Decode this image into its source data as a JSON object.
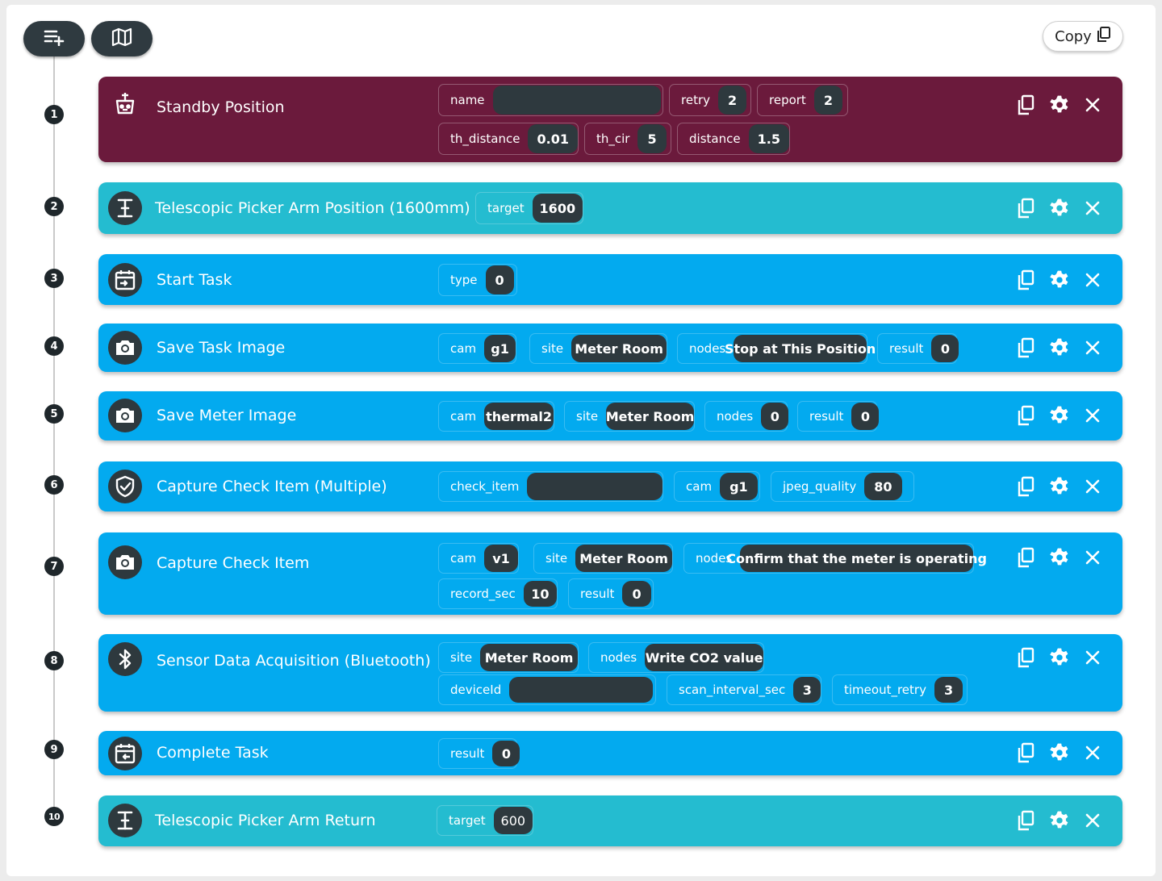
{
  "toolbar": {
    "add_icon": "playlist-add-icon",
    "map_icon": "map-icon",
    "copy_label": "Copy",
    "copy_icon": "copy-icon"
  },
  "colors": {
    "maroon": "#6b1a3c",
    "teal": "#24bcd0",
    "blue": "#03aaef",
    "pill": "#2e393e"
  },
  "steps": [
    {
      "number": "1",
      "title": "Standby Position",
      "icon": "robot-base-icon",
      "params": [
        {
          "label": "name",
          "value": ""
        },
        {
          "label": "retry",
          "value": "2"
        },
        {
          "label": "report",
          "value": "2"
        },
        {
          "label": "th_distance",
          "value": "0.01"
        },
        {
          "label": "th_cir",
          "value": "5"
        },
        {
          "label": "distance",
          "value": "1.5"
        }
      ]
    },
    {
      "number": "2",
      "title": "Telescopic Picker Arm Position (1600mm)",
      "icon": "telescopic-arm-icon",
      "params": [
        {
          "label": "target",
          "value": "1600"
        }
      ]
    },
    {
      "number": "3",
      "title": "Start Task",
      "icon": "calendar-start-icon",
      "params": [
        {
          "label": "type",
          "value": "0"
        }
      ]
    },
    {
      "number": "4",
      "title": "Save Task Image",
      "icon": "camera-icon",
      "params": [
        {
          "label": "cam",
          "value": "g1"
        },
        {
          "label": "site",
          "value": "Meter Room"
        },
        {
          "label": "nodes",
          "value": "Stop at This Position"
        },
        {
          "label": "result",
          "value": "0"
        }
      ]
    },
    {
      "number": "5",
      "title": "Save Meter Image",
      "icon": "camera-icon",
      "params": [
        {
          "label": "cam",
          "value": "thermal2"
        },
        {
          "label": "site",
          "value": "Meter Room"
        },
        {
          "label": "nodes",
          "value": "0"
        },
        {
          "label": "result",
          "value": "0"
        }
      ]
    },
    {
      "number": "6",
      "title": "Capture Check Item (Multiple)",
      "icon": "shield-check-icon",
      "params": [
        {
          "label": "check_item",
          "value": ""
        },
        {
          "label": "cam",
          "value": "g1"
        },
        {
          "label": "jpeg_quality",
          "value": "80"
        }
      ]
    },
    {
      "number": "7",
      "title": "Capture Check Item",
      "icon": "camera-icon",
      "params": [
        {
          "label": "cam",
          "value": "v1"
        },
        {
          "label": "site",
          "value": "Meter Room"
        },
        {
          "label": "nodes",
          "value": "Confirm that the meter is operating"
        },
        {
          "label": "record_sec",
          "value": "10"
        },
        {
          "label": "result",
          "value": "0"
        }
      ]
    },
    {
      "number": "8",
      "title": "Sensor Data Acquisition (Bluetooth)",
      "icon": "bluetooth-icon",
      "params": [
        {
          "label": "site",
          "value": "Meter Room"
        },
        {
          "label": "nodes",
          "value": "Write CO2 value"
        },
        {
          "label": "deviceId",
          "value": ""
        },
        {
          "label": "scan_interval_sec",
          "value": "3"
        },
        {
          "label": "timeout_retry",
          "value": "3"
        }
      ]
    },
    {
      "number": "9",
      "title": "Complete Task",
      "icon": "calendar-complete-icon",
      "params": [
        {
          "label": "result",
          "value": "0"
        }
      ]
    },
    {
      "number": "10",
      "title": "Telescopic Picker Arm Return",
      "icon": "telescopic-arm-icon",
      "params": [
        {
          "label": "target",
          "value": "600"
        }
      ]
    }
  ]
}
